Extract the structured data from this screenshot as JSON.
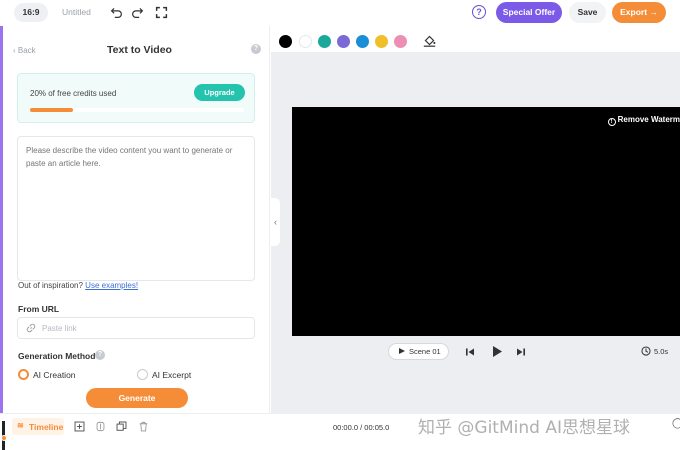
{
  "topbar": {
    "aspect_ratio": "16:9",
    "project_title": "Untitled",
    "special_offer_label": "Special Offer",
    "save_label": "Save",
    "export_label": "Export →"
  },
  "panel": {
    "back_label": "Back",
    "title": "Text to Video",
    "credits": {
      "text": "20% of free credits used",
      "used_fraction": 0.2,
      "upgrade_label": "Upgrade"
    },
    "prompt_placeholder": "Please describe the video content you want to generate or paste an article here.",
    "inspiration_text": "Out of inspiration?",
    "examples_link": "Use examples!",
    "from_url_label": "From URL",
    "url_placeholder": "Paste link",
    "generation_method_label": "Generation Method",
    "methods": [
      {
        "label": "AI Creation",
        "selected": true
      },
      {
        "label": "AI Excerpt",
        "selected": false
      }
    ],
    "generate_label": "Generate"
  },
  "palette": {
    "colors": [
      "#000000",
      "#ffffff",
      "#1aa89b",
      "#7b6ad6",
      "#1a8fd6",
      "#f0c02a",
      "#ec8fb2"
    ]
  },
  "preview": {
    "remove_watermark_label": "Remove Waterm",
    "scene_label": "Scene 01",
    "duration": "5.0s"
  },
  "timeline": {
    "tab_label": "Timeline",
    "time_readout": "00:00.0 / 00:05.0"
  },
  "overlay": {
    "text": "知乎 @GitMind AI思想星球"
  }
}
